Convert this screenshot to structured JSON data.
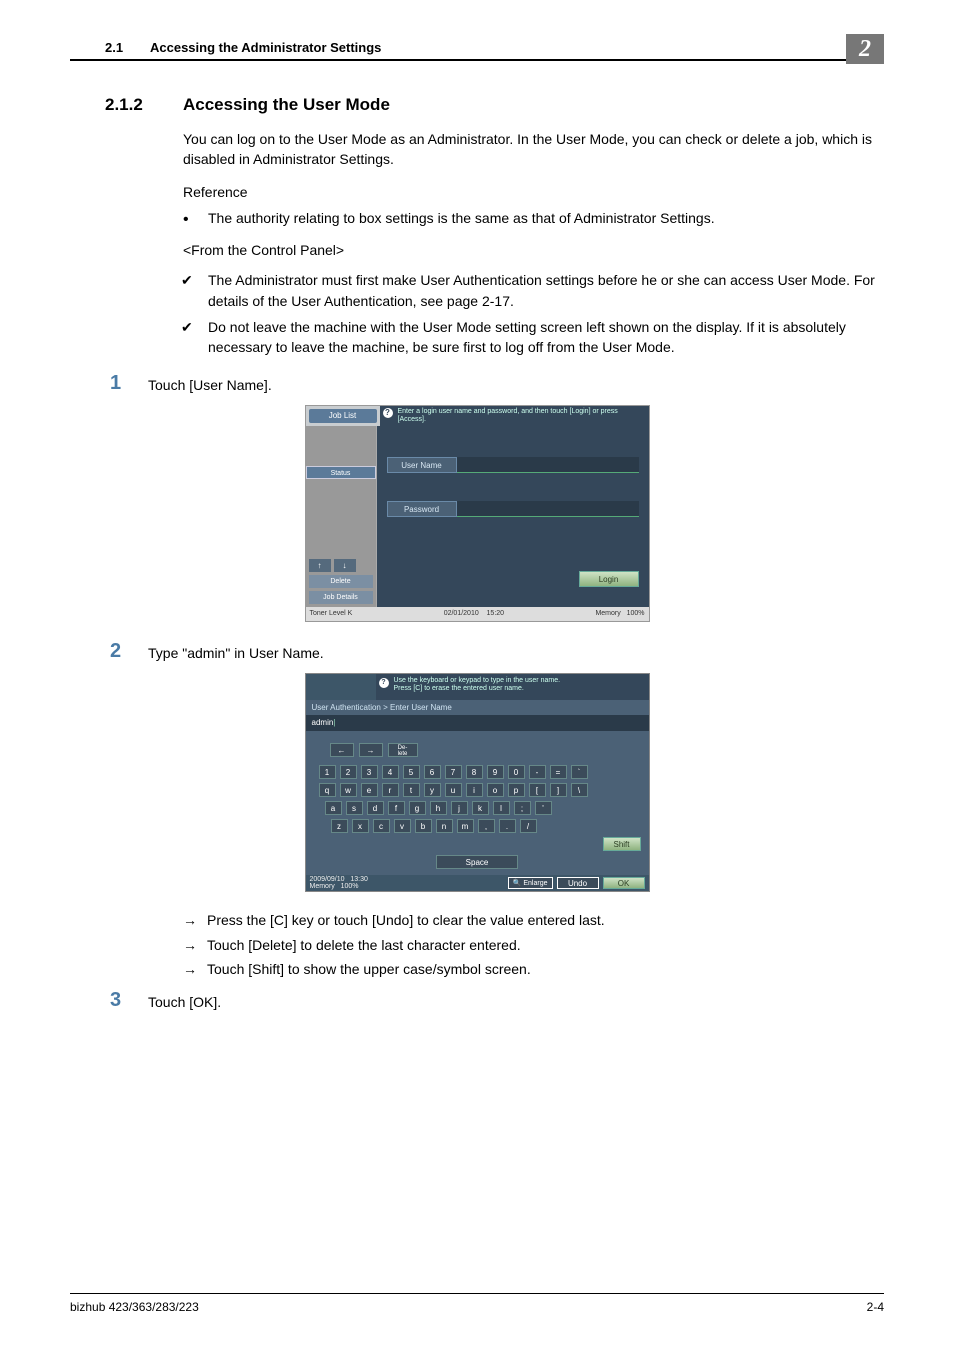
{
  "header": {
    "section_num": "2.1",
    "section_title": "Accessing the Administrator Settings",
    "chapter": "2"
  },
  "heading": {
    "num": "2.1.2",
    "title": "Accessing the User Mode"
  },
  "paras": {
    "intro": "You can log on to the User Mode as an Administrator. In the User Mode, you can check or delete a job, which is disabled in Administrator Settings.",
    "reference": "Reference",
    "bullet1": "The authority relating to box settings is the same as that of Administrator Settings.",
    "from": "<From the Control Panel>",
    "check1": "The Administrator must first make User Authentication settings before he or she can access User Mode. For details of the User Authentication, see page 2-17.",
    "check2": "Do not leave the machine with the User Mode setting screen left shown on the display. If it is absolutely necessary to leave the machine, be sure first to log off from the User Mode."
  },
  "steps": {
    "1": "Touch [User Name].",
    "2": "Type \"admin\" in User Name.",
    "3": "Touch [OK]."
  },
  "arrows": {
    "a": "Press the [C] key or touch [Undo] to clear the value entered last.",
    "b": "Touch [Delete] to delete the last character entered.",
    "c": "Touch [Shift] to show the upper case/symbol screen."
  },
  "panel1": {
    "job_list": "Job List",
    "msg": "Enter a login user name and password, and then touch [Login] or press [Access].",
    "status": "Status",
    "user": "User Name",
    "pass": "Password",
    "delete": "Delete",
    "details": "Job Details",
    "login": "Login",
    "toner": "Toner Level  K",
    "date": "02/01/2010",
    "time": "15:20",
    "mem": "Memory",
    "memval": "100%"
  },
  "panel2": {
    "msg": "Use the keyboard or keypad to type in the user name.\nPress [C] to erase the entered user name.",
    "crumb": "User Authentication > Enter User Name",
    "value": "admin",
    "del": "De-\nlete",
    "row1": [
      "1",
      "2",
      "3",
      "4",
      "5",
      "6",
      "7",
      "8",
      "9",
      "0",
      "-",
      "=",
      "`"
    ],
    "row2": [
      "q",
      "w",
      "e",
      "r",
      "t",
      "y",
      "u",
      "i",
      "o",
      "p",
      "[",
      "]",
      "\\"
    ],
    "row3": [
      "a",
      "s",
      "d",
      "f",
      "g",
      "h",
      "j",
      "k",
      "l",
      ";",
      "'"
    ],
    "row4": [
      "z",
      "x",
      "c",
      "v",
      "b",
      "n",
      "m",
      ",",
      ".",
      "/"
    ],
    "shift": "Shift",
    "space": "Space",
    "date": "2009/09/10",
    "time": "13:30",
    "mem": "Memory",
    "memval": "100%",
    "enlarge": "Enlarge",
    "undo": "Undo",
    "ok": "OK"
  },
  "footer": {
    "model": "bizhub 423/363/283/223",
    "page": "2-4"
  }
}
